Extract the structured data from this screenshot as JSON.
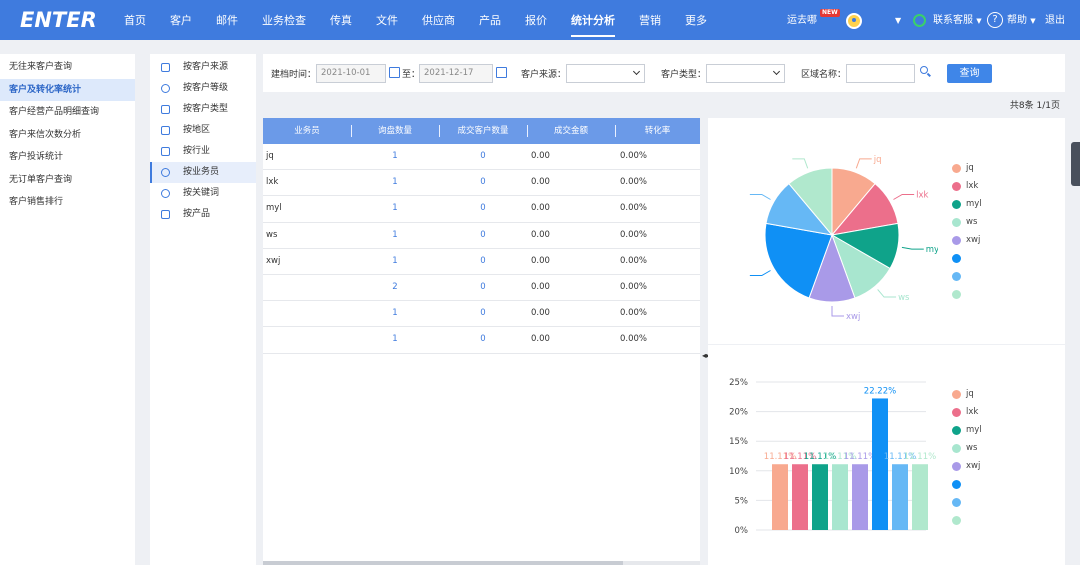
{
  "app": {
    "logo": "ENTER"
  },
  "nav": {
    "items": [
      "首页",
      "客户",
      "邮件",
      "业务检查",
      "传真",
      "文件",
      "供应商",
      "产品",
      "报价",
      "统计分析",
      "营销",
      "更多"
    ],
    "active_index": 9
  },
  "header_right": {
    "user_name": "运去哪",
    "new_badge": "NEW",
    "service": "联系客服",
    "help": "帮助",
    "logout": "退出"
  },
  "sidebar_main": {
    "items": [
      "无往来客户查询",
      "客户及转化率统计",
      "客户经营产品明细查询",
      "客户来信次数分析",
      "客户投诉统计",
      "无订单客户查询",
      "客户销售排行"
    ],
    "active_index": 1
  },
  "sidebar_sub": {
    "items": [
      {
        "label": "按客户来源",
        "icon": "share-icon"
      },
      {
        "label": "按客户等级",
        "icon": "diamond-icon"
      },
      {
        "label": "按客户类型",
        "icon": "grid-icon"
      },
      {
        "label": "按地区",
        "icon": "location-icon"
      },
      {
        "label": "按行业",
        "icon": "trend-icon"
      },
      {
        "label": "按业务员",
        "icon": "user-icon"
      },
      {
        "label": "按关键词",
        "icon": "target-icon"
      },
      {
        "label": "按产品",
        "icon": "box-icon"
      }
    ],
    "active_index": 5
  },
  "filter": {
    "date_label": "建档时间：",
    "date_from": "2021-10-01",
    "to_label": "至：",
    "date_to": "2021-12-17",
    "source_label": "客户来源：",
    "type_label": "客户类型：",
    "region_label": "区域名称：",
    "region_value": "",
    "query_button": "查询"
  },
  "record_count": "共8条 1/1页",
  "table": {
    "columns": [
      "业务员",
      "询盘数量",
      "成交客户数量",
      "成交金额",
      "转化率"
    ],
    "rows": [
      [
        "jq",
        "1",
        "0",
        "0.00",
        "0.00%"
      ],
      [
        "lxk",
        "1",
        "0",
        "0.00",
        "0.00%"
      ],
      [
        "myl",
        "1",
        "0",
        "0.00",
        "0.00%"
      ],
      [
        "ws",
        "1",
        "0",
        "0.00",
        "0.00%"
      ],
      [
        "xwj",
        "1",
        "0",
        "0.00",
        "0.00%"
      ],
      [
        "",
        "2",
        "0",
        "0.00",
        "0.00%"
      ],
      [
        "",
        "1",
        "0",
        "0.00",
        "0.00%"
      ],
      [
        "",
        "1",
        "0",
        "0.00",
        "0.00%"
      ]
    ]
  },
  "chart_data": [
    {
      "type": "pie",
      "categories": [
        "jq",
        "lxk",
        "myl",
        "ws",
        "xwj",
        "",
        "",
        ""
      ],
      "values": [
        1,
        1,
        1,
        1,
        1,
        2,
        1,
        1
      ],
      "colors": [
        "#f8a98f",
        "#ec6f8b",
        "#0fa38a",
        "#a8e6cf",
        "#a99ae8",
        "#0f90f5",
        "#66b8f5",
        "#b0e8cd"
      ],
      "legend": "right"
    },
    {
      "type": "bar",
      "categories": [
        "jq",
        "lxk",
        "myl",
        "ws",
        "xwj",
        "",
        "",
        ""
      ],
      "values": [
        11.11,
        11.11,
        11.11,
        11.11,
        11.11,
        22.22,
        11.11,
        11.11
      ],
      "value_labels": [
        "11.11%",
        "11.11%",
        "11.11%",
        "11.11%",
        "11.11%",
        "22.22%",
        "11.11%",
        "11.11%"
      ],
      "colors": [
        "#f8a98f",
        "#ec6f8b",
        "#0fa38a",
        "#a8e6cf",
        "#a99ae8",
        "#0f90f5",
        "#66b8f5",
        "#b0e8cd"
      ],
      "ylim": [
        0,
        25
      ],
      "yticks": [
        "0%",
        "5%",
        "10%",
        "15%",
        "20%",
        "25%"
      ],
      "grid": true,
      "legend": "right"
    }
  ]
}
